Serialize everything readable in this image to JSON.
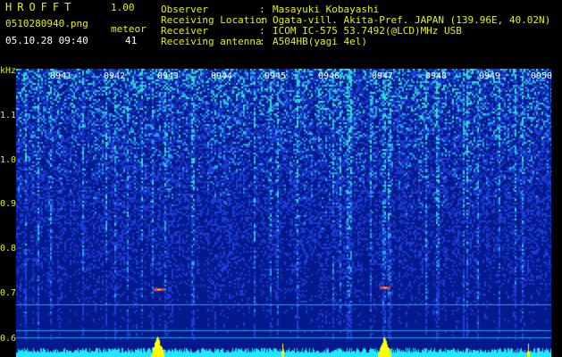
{
  "header": {
    "app_title": "HROFFT",
    "app_version": "1.00",
    "file_name": "0510280940.png",
    "meteor_label": "meteor",
    "timestamp": "05.10.28 09:40",
    "meteor_count": "41"
  },
  "station_info": [
    {
      "label": "Observer",
      "value": "Masayuki Kobayashi"
    },
    {
      "label": "Receiving Location",
      "value": "Ogata-vill. Akita-Pref. JAPAN (139.96E, 40.02N)"
    },
    {
      "label": "Receiver",
      "value": "ICOM IC-575 53.7492(@LCD)MHz USB"
    },
    {
      "label": "Receiving antenna",
      "value": "A504HB(yagi 4el)"
    }
  ],
  "separator": ":",
  "axis": {
    "unit_label": "kHz",
    "freq_ticks": [
      "1.1",
      "1.0",
      "0.9",
      "0.8",
      "0.7",
      "0.6"
    ],
    "time_ticks": [
      "0941",
      "0942",
      "0943",
      "0944",
      "0945",
      "0946",
      "0947",
      "0948",
      "0949",
      "0950"
    ]
  },
  "colors": {
    "header_text": "#e8f000",
    "info_text": "#ffffff",
    "background": "#041a8c",
    "noise_low": "#1c3cd8",
    "noise_mid": "#24a0e8",
    "noise_high": "#30e0c8",
    "meteor_echo": "#ff3030",
    "baseline": "#22e8ff",
    "peak": "#ffff00"
  }
}
